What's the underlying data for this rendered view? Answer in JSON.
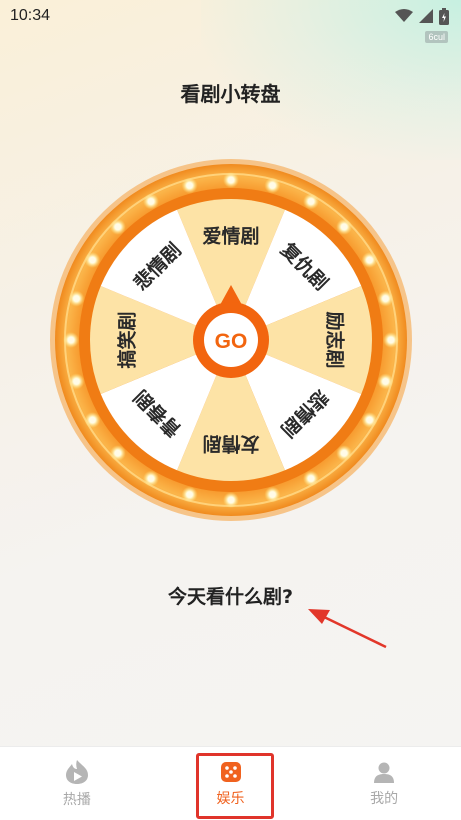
{
  "status_bar": {
    "time": "10:34",
    "icons": [
      "wifi-icon",
      "signal-icon",
      "battery-icon"
    ]
  },
  "watermark": "6cul",
  "page": {
    "title": "看剧小转盘",
    "question": "今天看什么剧?"
  },
  "wheel": {
    "center_label": "GO",
    "segments": [
      "爱情剧",
      "复仇剧",
      "励志剧",
      "悲情剧",
      "友情剧",
      "青春剧",
      "搞笑剧",
      "悲情剧"
    ]
  },
  "tab_bar": {
    "tabs": [
      {
        "label": "热播",
        "icon": "play-flame-icon",
        "active": false
      },
      {
        "label": "娱乐",
        "icon": "dice-icon",
        "active": true
      },
      {
        "label": "我的",
        "icon": "person-icon",
        "active": false
      }
    ]
  },
  "colors": {
    "accent": "#f0621f",
    "wheel_rim": "#f7a23c",
    "segment_light": "#ffffff",
    "segment_tint": "#fde3a6",
    "highlight_box": "#e0342a"
  }
}
